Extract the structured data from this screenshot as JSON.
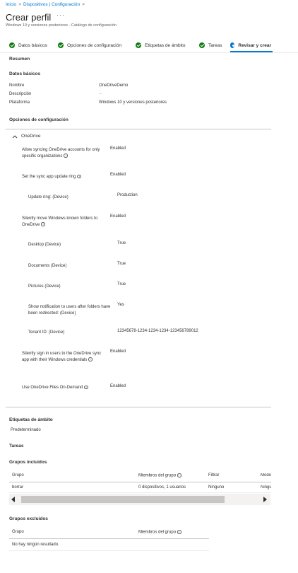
{
  "breadcrumb": {
    "items": [
      "Inicio",
      "Dispositivos | Configuración"
    ],
    "trail": ">"
  },
  "header": {
    "title": "Crear perfil",
    "more": "···",
    "subtitle": "Windows 10 y versiones posteriores - Catálogo de configuración"
  },
  "wizard": {
    "tabs": [
      {
        "label": "Datos básicos",
        "status": "done"
      },
      {
        "label": "Opciones de configuración",
        "status": "done"
      },
      {
        "label": "Etiquetas de ámbito",
        "status": "done"
      },
      {
        "label": "Tareas",
        "status": "done"
      },
      {
        "label": "Revisar y crear",
        "status": "current"
      }
    ]
  },
  "summary": {
    "heading": "Resumen"
  },
  "basics": {
    "heading": "Datos básicos",
    "rows": [
      {
        "label": "Nombre",
        "value": "OneDriveDemo"
      },
      {
        "label": "Descripción",
        "value": "--"
      },
      {
        "label": "Plataforma",
        "value": "Windows 10 y versiones posteriores"
      }
    ]
  },
  "config": {
    "heading": "Opciones de configuración",
    "group": "OneDrive",
    "chevron": "chevron-up-icon",
    "settings": [
      {
        "label": "Allow syncing OneDrive accounts for only specific organizations",
        "info": true,
        "value": "Enabled",
        "indent": false
      },
      {
        "label": "Set the sync app update ring",
        "info": true,
        "value": "Enabled",
        "indent": false
      },
      {
        "label": "Update ring: (Device)",
        "info": false,
        "value": "Production",
        "indent": true
      },
      {
        "label": "Silently move Windows known folders to OneDrive",
        "info": true,
        "value": "Enabled",
        "indent": false
      },
      {
        "label": "Desktop (Device)",
        "info": false,
        "value": "True",
        "indent": true
      },
      {
        "label": "Documents (Device)",
        "info": false,
        "value": "True",
        "indent": true
      },
      {
        "label": "Pictures (Device)",
        "info": false,
        "value": "True",
        "indent": true
      },
      {
        "label": "Show notification to users after folders have been redirected: (Device)",
        "info": false,
        "value": "Yes",
        "indent": true
      },
      {
        "label": "Tenant ID: (Device)",
        "info": false,
        "value": "12345678-1234-1234-1234-123456789012",
        "indent": true
      },
      {
        "label": "Silently sign in users to the OneDrive sync app with their Windows credentials",
        "info": true,
        "value": "Enabled",
        "indent": false
      },
      {
        "label": "Use OneDrive Files On-Demand",
        "info": true,
        "value": "Enabled",
        "indent": false
      }
    ]
  },
  "scope": {
    "heading": "Etiquetas de ámbito",
    "value": "Predeterminado"
  },
  "assignments": {
    "heading": "Tareas",
    "included": {
      "heading": "Grupos incluidos",
      "columns": [
        "Grupo",
        "Miembros del grupo",
        "Filtrar",
        "Modo de filtro"
      ],
      "rows": [
        [
          "borrar",
          "0 dispositivos, 1 usuarios",
          "Ninguno",
          "Ninguno"
        ]
      ]
    },
    "excluded": {
      "heading": "Grupos excluidos",
      "columns": [
        "Grupo",
        "Miembros del grupo"
      ],
      "empty": "No hay ningún resultado."
    }
  },
  "colors": {
    "accent": "#0078d4",
    "success": "#107c10",
    "text": "#323130",
    "muted": "#605e5c"
  }
}
